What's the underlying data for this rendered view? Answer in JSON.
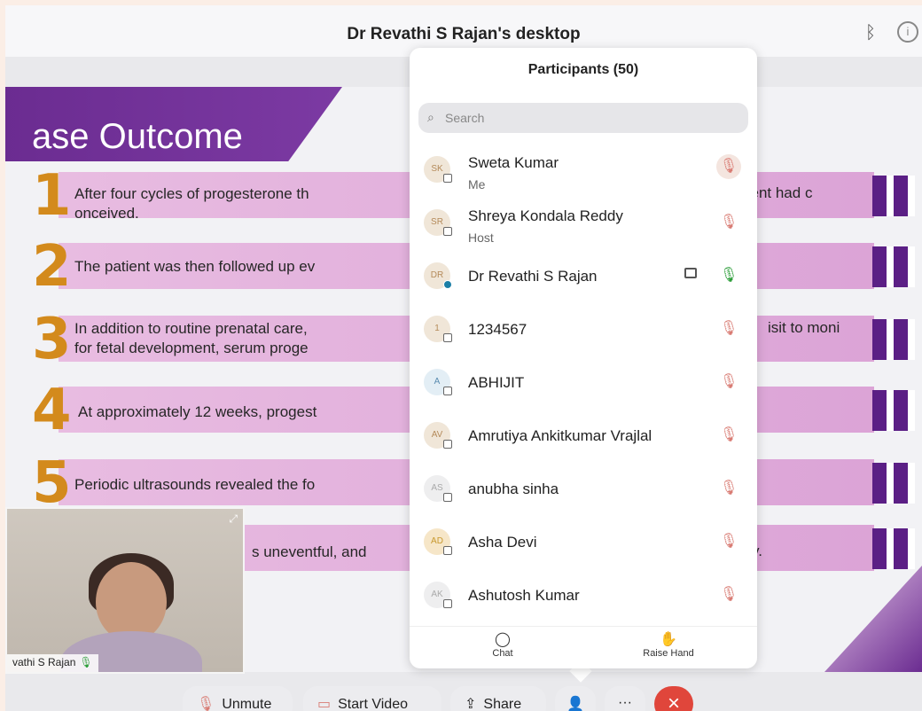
{
  "window": {
    "title": "Dr Revathi S Rajan's desktop"
  },
  "slide": {
    "title": "ase Outcome",
    "rows": [
      {
        "num": "1",
        "text": "After four cycles of progesterone th",
        "text2": "onceived.",
        "right_text": "tient had c"
      },
      {
        "num": "2",
        "text": "The patient was then followed up ev"
      },
      {
        "num": "3",
        "text": "In addition to routine prenatal care,",
        "text2": "for fetal development, serum proge",
        "right_text": "isit to moni"
      },
      {
        "num": "4",
        "text": "At approximately 12 weeks, progest"
      },
      {
        "num": "5",
        "text": "Periodic ultrasounds revealed the fo"
      },
      {
        "num": "",
        "text": "s uneventful, and",
        "right_text": "y."
      }
    ]
  },
  "video": {
    "name": "vathi S Rajan"
  },
  "participants": {
    "title": "Participants (50)",
    "search_placeholder": "Search",
    "items": [
      {
        "initials": "SK",
        "name": "Sweta Kumar",
        "role": "Me"
      },
      {
        "initials": "SR",
        "name": "Shreya Kondala Reddy",
        "role": "Host"
      },
      {
        "initials": "DR",
        "name": "Dr Revathi S Rajan",
        "role": ""
      },
      {
        "initials": "1",
        "name": "1234567",
        "role": ""
      },
      {
        "initials": "A",
        "name": "ABHIJIT",
        "role": ""
      },
      {
        "initials": "AV",
        "name": "Amrutiya Ankitkumar Vrajlal",
        "role": ""
      },
      {
        "initials": "AS",
        "name": "anubha sinha",
        "role": ""
      },
      {
        "initials": "AD",
        "name": "Asha Devi",
        "role": ""
      },
      {
        "initials": "AK",
        "name": "Ashutosh Kumar",
        "role": ""
      }
    ],
    "footer": {
      "chat": "Chat",
      "raise_hand": "Raise Hand"
    }
  },
  "toolbar": {
    "unmute": "Unmute",
    "start_video": "Start Video",
    "share": "Share",
    "more": "···"
  }
}
